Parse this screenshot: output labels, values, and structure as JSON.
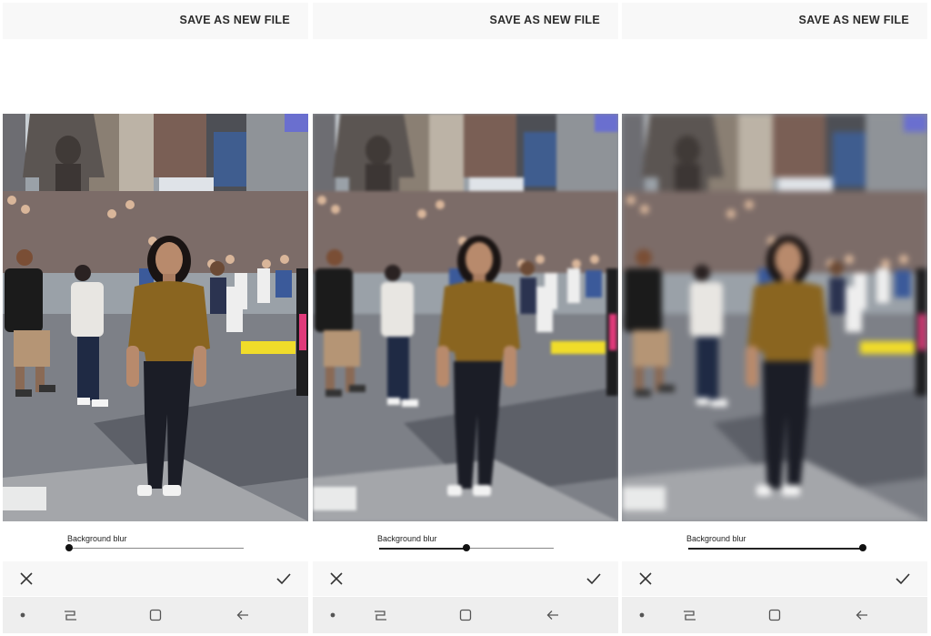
{
  "screens": [
    {
      "save_label": "SAVE AS NEW FILE",
      "slider_label": "Background blur",
      "blur_level": 0.0
    },
    {
      "save_label": "SAVE AS NEW FILE",
      "slider_label": "Background blur",
      "blur_level": 0.5
    },
    {
      "save_label": "SAVE AS NEW FILE",
      "slider_label": "Background blur",
      "blur_level": 1.0
    }
  ],
  "icons": {
    "cancel": "close-icon",
    "apply": "check-icon",
    "nav": [
      "dot-icon",
      "recent-apps-icon",
      "home-icon",
      "back-icon"
    ]
  },
  "colors": {
    "slider_track": "#888888",
    "slider_thumb": "#111111",
    "highlight_yellow": "#f0dc2a",
    "shirt_olive": "#8a6520"
  }
}
